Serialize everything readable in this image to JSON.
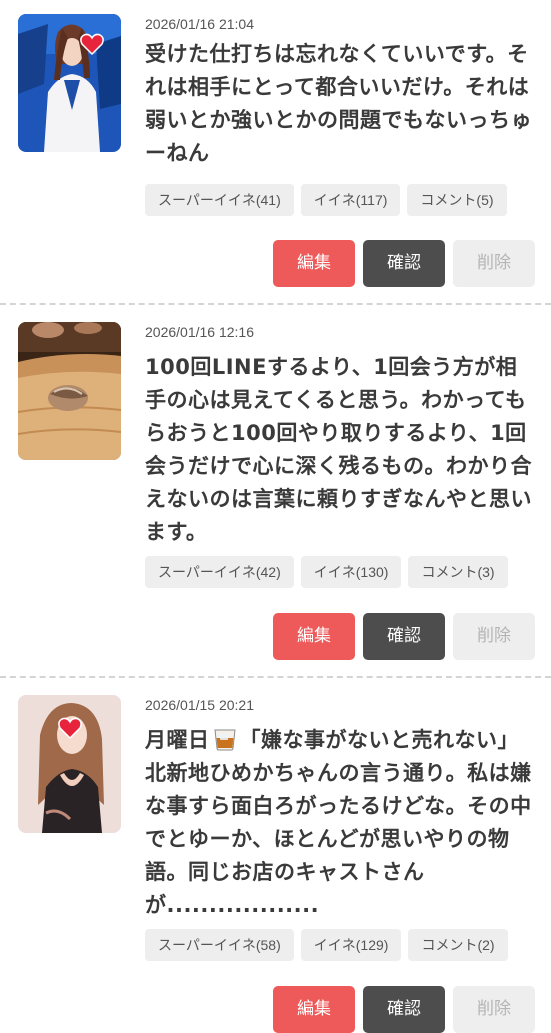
{
  "posts": [
    {
      "thumbnail": "woman-in-white-jacket",
      "date": "2026/01/16 21:04",
      "text": "受けた仕打ちは忘れなくていいです。それは相手にとって都合いいだけ。それは弱いとか強いとかの問題でもないっちゅーねん",
      "tags": {
        "super_like": "スーパーイイネ(41)",
        "like": "イイネ(117)",
        "comment": "コメント(5)"
      },
      "actions": {
        "edit": "編集",
        "confirm": "確認",
        "delete": "削除"
      }
    },
    {
      "thumbnail": "sushi-on-wooden-board",
      "date": "2026/01/16 12:16",
      "text": "100回LINEするより、1回会う方が相手の心は見えてくると思う。わかってもらおうと100回やり取りするより、1回会うだけで心に深く残るもの。わかり合えないのは言葉に頼りすぎなんやと思います。",
      "tags": {
        "super_like": "スーパーイイネ(42)",
        "like": "イイネ(130)",
        "comment": "コメント(3)"
      },
      "actions": {
        "edit": "編集",
        "confirm": "確認",
        "delete": "削除"
      }
    },
    {
      "thumbnail": "woman-in-black-dress",
      "date": "2026/01/15 20:21",
      "text_before_emoji": "月曜日",
      "emoji": "whisky-glass-emoji",
      "text_after_emoji": "「嫌な事がないと売れない」北新地ひめかちゃんの言う通り。私は嫌な事すら面白ろがったるけどな。その中でとゆーか、ほとんどが思いやりの物語。同じお店のキャストさんが..................",
      "tags": {
        "super_like": "スーパーイイネ(58)",
        "like": "イイネ(129)",
        "comment": "コメント(2)"
      },
      "actions": {
        "edit": "編集",
        "confirm": "確認",
        "delete": "削除"
      }
    }
  ],
  "colors": {
    "edit": "#ee5a5a",
    "confirm": "#4d4d4d",
    "delete": "#eeeeee",
    "tag": "#eeeeee",
    "heart": "#e8243c"
  }
}
